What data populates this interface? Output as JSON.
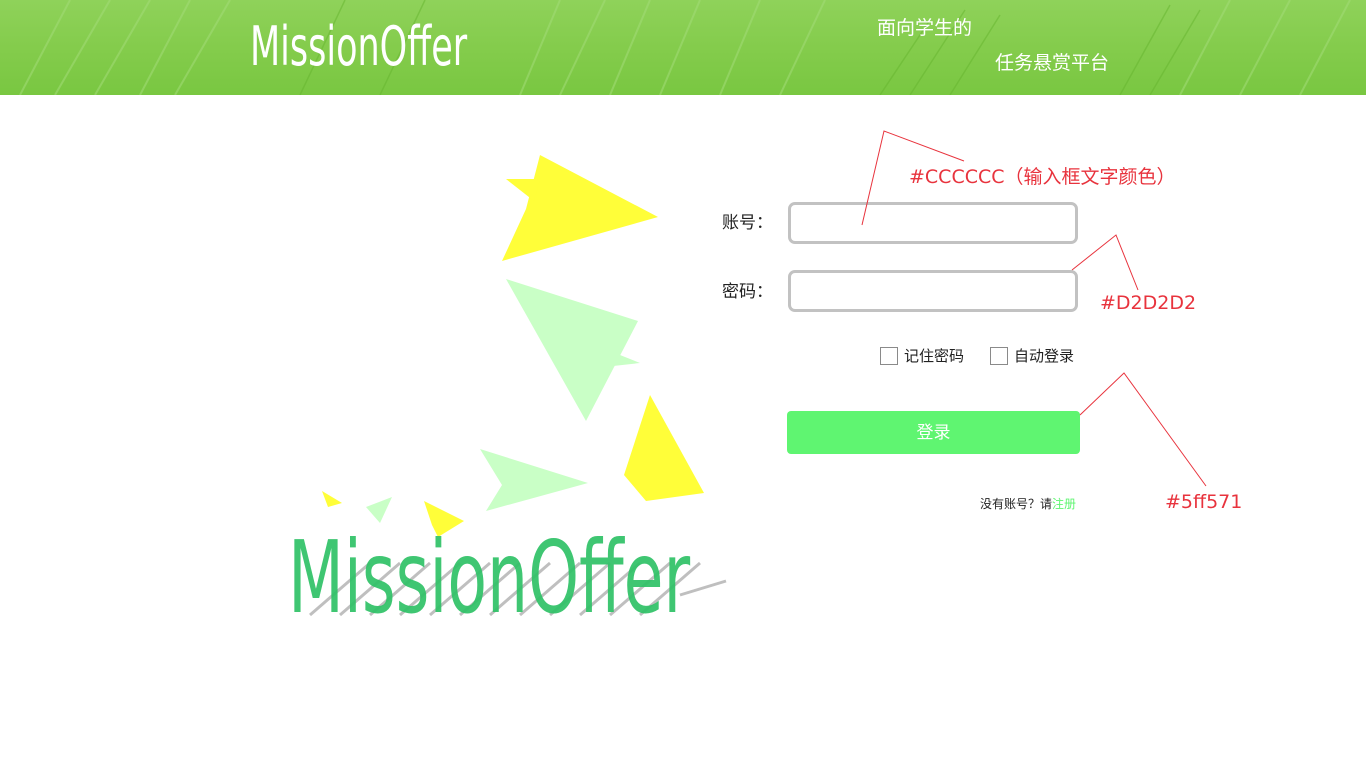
{
  "header": {
    "logo_text": "MissionOffer",
    "logo_mark": "Ⓡ",
    "slogan_line1": "面向学生的",
    "slogan_line2": "任务悬赏平台"
  },
  "illustration": {
    "logo_text": "MissionOffer",
    "logo_mark": "Ⓡ",
    "icon": "paper-planes-illustration"
  },
  "form": {
    "account_label": "账号：",
    "password_label": "密码：",
    "account_value": "",
    "password_value": "",
    "remember_label": "记住密码",
    "auto_login_label": "自动登录",
    "login_button_label": "登录",
    "register_prompt": "没有账号？请",
    "register_link": "注册"
  },
  "annotations": {
    "input_text_color": "#CCCCCC（输入框文字颜色）",
    "input_border_color": "#D2D2D2",
    "button_color": "#5ff571"
  },
  "colors": {
    "header_green": "#84cc4c",
    "button_green": "#5ff571",
    "input_text": "#CCCCCC",
    "input_border": "#D2D2D2",
    "annotation_red": "#e8333d"
  }
}
